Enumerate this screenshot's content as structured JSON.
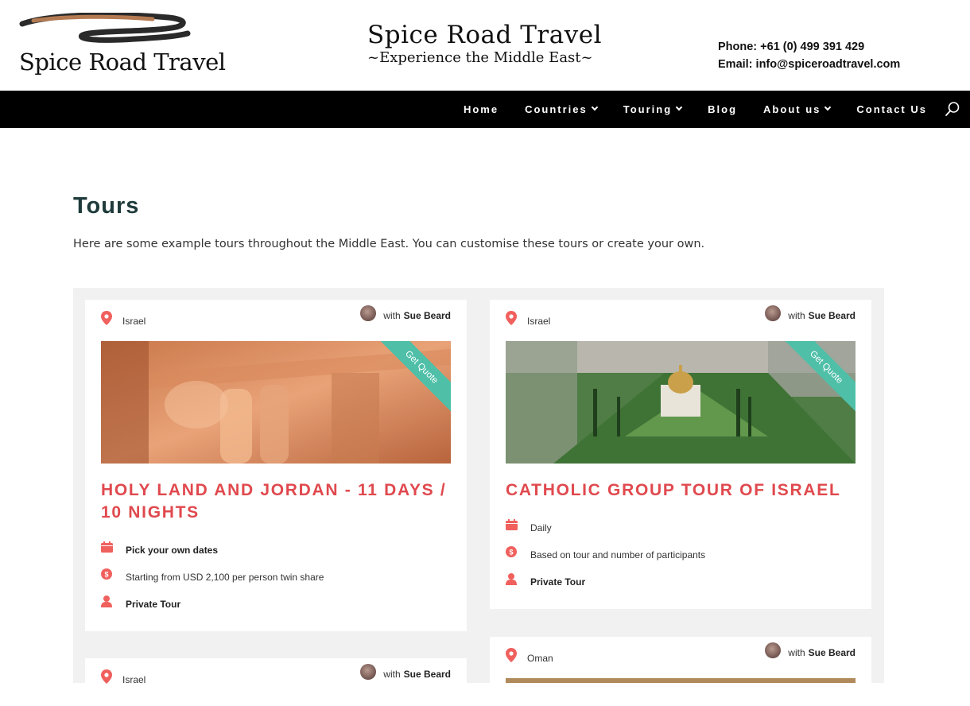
{
  "header": {
    "logo_left_text": "Spice Road Travel",
    "logo_center_main": "Spice Road Travel",
    "logo_center_sub": "~Experience the Middle East~",
    "phone": "Phone: +61 (0) 499 391 429",
    "email": "Email: info@spiceroadtravel.com"
  },
  "nav": {
    "items": [
      {
        "label": "Home",
        "has_dropdown": false
      },
      {
        "label": "Countries",
        "has_dropdown": true
      },
      {
        "label": "Touring",
        "has_dropdown": true
      },
      {
        "label": "Blog",
        "has_dropdown": false
      },
      {
        "label": "About us",
        "has_dropdown": true
      },
      {
        "label": "Contact Us",
        "has_dropdown": false
      }
    ],
    "search_icon": "search-icon"
  },
  "page": {
    "title": "Tours",
    "intro": "Here are some example tours throughout the Middle East. You can customise these tours or create your own."
  },
  "colors": {
    "title": "#e0494e",
    "icon": "#f0605d",
    "ribbon": "#4fbfa8",
    "heading": "#1e3a3a",
    "navbar": "#000000"
  },
  "tours": [
    {
      "country": "Israel",
      "guide_prefix": "with",
      "guide": "Sue Beard",
      "ribbon": "Get Quote",
      "title": "HOLY LAND AND JORDAN - 11 DAYS / 10 NIGHTS",
      "dates": "Pick your own dates",
      "price": "Starting from USD 2,100 per person twin share",
      "type": "Private Tour"
    },
    {
      "country": "Israel",
      "guide_prefix": "with",
      "guide": "Sue Beard",
      "ribbon": "Get Quote",
      "title": "CATHOLIC GROUP TOUR OF ISRAEL",
      "dates": "Daily",
      "price": "Based on tour and number of participants",
      "type": "Private Tour"
    },
    {
      "country": "Israel",
      "guide_prefix": "with",
      "guide": "Sue Beard"
    },
    {
      "country": "Oman",
      "guide_prefix": "with",
      "guide": "Sue Beard"
    }
  ]
}
